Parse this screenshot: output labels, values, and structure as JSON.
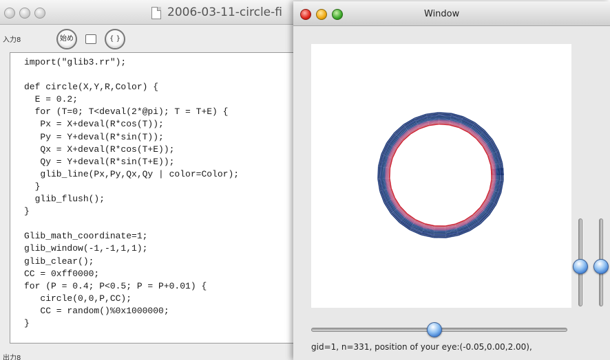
{
  "editor": {
    "document_title": "2006-03-11-circle-fi",
    "input_label": "入力8",
    "output_label": "出力8",
    "start_button_label": "始め",
    "braces_button_label": "{ }",
    "code_lines": [
      "import(\"glib3.rr\");",
      "",
      "def circle(X,Y,R,Color) {",
      "  E = 0.2;",
      "  for (T=0; T<deval(2*@pi); T = T+E) {",
      "   Px = X+deval(R*cos(T));",
      "   Py = Y+deval(R*sin(T));",
      "   Qx = X+deval(R*cos(T+E));",
      "   Qy = Y+deval(R*sin(T+E));",
      "   glib_line(Px,Py,Qx,Qy | color=Color);",
      "  }",
      "  glib_flush();",
      "}",
      "",
      "Glib_math_coordinate=1;",
      "glib_window(-1,-1,1,1);",
      "glib_clear();",
      "CC = 0xff0000;",
      "for (P = 0.4; P<0.5; P = P+0.01) {",
      "   circle(0,0,P,CC);",
      "   CC = random()%0x1000000;",
      "}"
    ]
  },
  "graphics_window": {
    "title": "Window",
    "status_text": "gid=1, n=331, position of your eye:(-0.05,0.00,2.00),",
    "horizontal_slider_level": 0.48,
    "vertical_slider_levels": [
      0.45,
      0.45
    ],
    "ring_colors": [
      "#cc2233",
      "#c0627e",
      "#b45a8a",
      "#8a4c86",
      "#2a4a8a",
      "#1c3e7e",
      "#14366e",
      "#203c86",
      "#16306a",
      "#223d7d"
    ]
  },
  "colors": {
    "circle_red": "#cc2233",
    "accent_blue": "#2e6ec8"
  }
}
